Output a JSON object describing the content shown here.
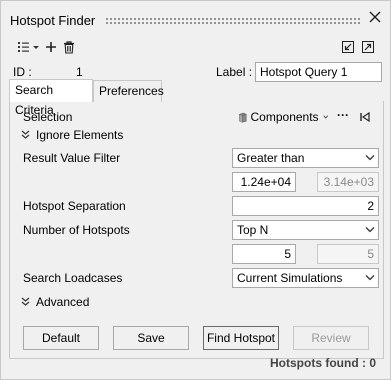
{
  "window": {
    "title": "Hotspot Finder"
  },
  "toolbar": {
    "list_icon": "list-dropdown-icon",
    "add_icon": "plus-icon",
    "delete_icon": "trash-icon",
    "collapse_icon": "shrink-window-icon",
    "expand_icon": "expand-window-icon"
  },
  "header": {
    "id_label": "ID :",
    "id_value": "1",
    "label_label": "Label :",
    "label_value": "Hotspot Query 1"
  },
  "tabs": [
    {
      "label": "Search Criteria",
      "active": true
    },
    {
      "label": "Preferences",
      "active": false
    }
  ],
  "criteria": {
    "selection_label": "Selection",
    "selection_value": "Components",
    "more": "···",
    "ignore_elements": "Ignore Elements",
    "result_value_filter_label": "Result Value Filter",
    "result_value_filter": "Greater than",
    "filter_value": "1.24e+04",
    "filter_value_hint": "3.14e+03",
    "hotspot_separation_label": "Hotspot Separation",
    "hotspot_separation": "2",
    "number_of_hotspots_label": "Number of Hotspots",
    "number_of_hotspots": "Top N",
    "top_n": "5",
    "top_n_secondary": "5",
    "search_loadcases_label": "Search Loadcases",
    "search_loadcases": "Current Simulations",
    "advanced": "Advanced"
  },
  "buttons": {
    "default": "Default",
    "save": "Save",
    "find": "Find Hotspot",
    "review": "Review"
  },
  "status": {
    "found": "Hotspots found : 0"
  }
}
